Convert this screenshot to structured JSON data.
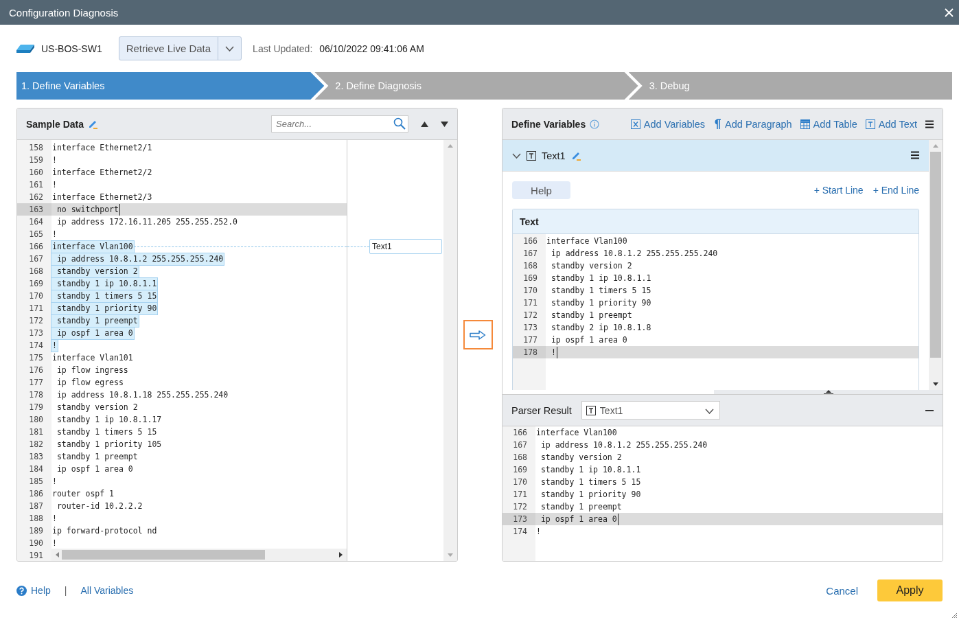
{
  "window": {
    "title": "Configuration Diagnosis"
  },
  "device": {
    "name": "US-BOS-SW1"
  },
  "retrieve_button": {
    "label": "Retrieve Live Data"
  },
  "last_updated": {
    "label": "Last Updated:",
    "value": "06/10/2022 09:41:06 AM"
  },
  "steps": [
    {
      "label": "1. Define Variables",
      "selected": true
    },
    {
      "label": "2. Define Diagnosis",
      "selected": false
    },
    {
      "label": "3. Debug",
      "selected": false
    }
  ],
  "sample_data": {
    "title": "Sample Data",
    "search_placeholder": "Search...",
    "annotation": "Text1",
    "lines": [
      {
        "number": "158",
        "text": "interface Ethernet2/1",
        "highlighted": false,
        "current": false
      },
      {
        "number": "159",
        "text": "!",
        "highlighted": false,
        "current": false
      },
      {
        "number": "160",
        "text": "interface Ethernet2/2",
        "highlighted": false,
        "current": false
      },
      {
        "number": "161",
        "text": "!",
        "highlighted": false,
        "current": false
      },
      {
        "number": "162",
        "text": "interface Ethernet2/3",
        "highlighted": false,
        "current": false
      },
      {
        "number": "163",
        "text": " no switchport",
        "highlighted": false,
        "current": true
      },
      {
        "number": "164",
        "text": " ip address 172.16.11.205 255.255.252.0",
        "highlighted": false,
        "current": false
      },
      {
        "number": "165",
        "text": "!",
        "highlighted": false,
        "current": false
      },
      {
        "number": "166",
        "text": "interface Vlan100",
        "highlighted": true,
        "current": false
      },
      {
        "number": "167",
        "text": " ip address 10.8.1.2 255.255.255.240",
        "highlighted": true,
        "current": false
      },
      {
        "number": "168",
        "text": " standby version 2",
        "highlighted": true,
        "current": false
      },
      {
        "number": "169",
        "text": " standby 1 ip 10.8.1.1",
        "highlighted": true,
        "current": false
      },
      {
        "number": "170",
        "text": " standby 1 timers 5 15",
        "highlighted": true,
        "current": false
      },
      {
        "number": "171",
        "text": " standby 1 priority 90",
        "highlighted": true,
        "current": false
      },
      {
        "number": "172",
        "text": " standby 1 preempt",
        "highlighted": true,
        "current": false
      },
      {
        "number": "173",
        "text": " ip ospf 1 area 0",
        "highlighted": true,
        "current": false
      },
      {
        "number": "174",
        "text": "!",
        "highlighted": true,
        "current": false
      },
      {
        "number": "175",
        "text": "interface Vlan101",
        "highlighted": false,
        "current": false
      },
      {
        "number": "176",
        "text": " ip flow ingress",
        "highlighted": false,
        "current": false
      },
      {
        "number": "177",
        "text": " ip flow egress",
        "highlighted": false,
        "current": false
      },
      {
        "number": "178",
        "text": " ip address 10.8.1.18 255.255.255.240",
        "highlighted": false,
        "current": false
      },
      {
        "number": "179",
        "text": " standby version 2",
        "highlighted": false,
        "current": false
      },
      {
        "number": "180",
        "text": " standby 1 ip 10.8.1.17",
        "highlighted": false,
        "current": false
      },
      {
        "number": "181",
        "text": " standby 1 timers 5 15",
        "highlighted": false,
        "current": false
      },
      {
        "number": "182",
        "text": " standby 1 priority 105",
        "highlighted": false,
        "current": false
      },
      {
        "number": "183",
        "text": " standby 1 preempt",
        "highlighted": false,
        "current": false
      },
      {
        "number": "184",
        "text": " ip ospf 1 area 0",
        "highlighted": false,
        "current": false
      },
      {
        "number": "185",
        "text": "!",
        "highlighted": false,
        "current": false
      },
      {
        "number": "186",
        "text": "router ospf 1",
        "highlighted": false,
        "current": false
      },
      {
        "number": "187",
        "text": " router-id 10.2.2.2",
        "highlighted": false,
        "current": false
      },
      {
        "number": "188",
        "text": "!",
        "highlighted": false,
        "current": false
      },
      {
        "number": "189",
        "text": "ip forward-protocol nd",
        "highlighted": false,
        "current": false
      },
      {
        "number": "190",
        "text": "!",
        "highlighted": false,
        "current": false
      },
      {
        "number": "191"
      }
    ]
  },
  "define_variables": {
    "title": "Define Variables",
    "actions": [
      {
        "label": "Add Variables",
        "kind": "variables"
      },
      {
        "label": "Add Paragraph",
        "kind": "paragraph"
      },
      {
        "label": "Add Table",
        "kind": "table"
      },
      {
        "label": "Add Text",
        "kind": "text"
      }
    ],
    "item": {
      "name": "Text1",
      "expanded": true,
      "help": "Help",
      "start_line": "+ Start Line",
      "end_line": "+ End Line",
      "text_box": {
        "title": "Text",
        "lines": [
          {
            "number": "166",
            "text": "interface Vlan100",
            "current": false
          },
          {
            "number": "167",
            "text": " ip address 10.8.1.2 255.255.255.240",
            "current": false
          },
          {
            "number": "168",
            "text": " standby version 2",
            "current": false
          },
          {
            "number": "169",
            "text": " standby 1 ip 10.8.1.1",
            "current": false
          },
          {
            "number": "170",
            "text": " standby 1 timers 5 15",
            "current": false
          },
          {
            "number": "171",
            "text": " standby 1 priority 90",
            "current": false
          },
          {
            "number": "172",
            "text": " standby 1 preempt",
            "current": false
          },
          {
            "number": "173",
            "text": " standby 2 ip 10.8.1.8",
            "current": false
          },
          {
            "number": "177",
            "text": " ip ospf 1 area 0",
            "current": false
          },
          {
            "number": "178",
            "text": " !",
            "current": true
          }
        ]
      }
    }
  },
  "parser_result": {
    "title": "Parser Result",
    "selected_variable": "Text1",
    "lines": [
      {
        "number": "166",
        "text": "interface Vlan100",
        "current": false
      },
      {
        "number": "167",
        "text": " ip address 10.8.1.2 255.255.255.240",
        "current": false
      },
      {
        "number": "168",
        "text": " standby version 2",
        "current": false
      },
      {
        "number": "169",
        "text": " standby 1 ip 10.8.1.1",
        "current": false
      },
      {
        "number": "170",
        "text": " standby 1 timers 5 15",
        "current": false
      },
      {
        "number": "171",
        "text": " standby 1 priority 90",
        "current": false
      },
      {
        "number": "172",
        "text": " standby 1 preempt",
        "current": false
      },
      {
        "number": "173",
        "text": " ip ospf 1 area 0",
        "current": true
      },
      {
        "number": "174",
        "text": "!",
        "current": false
      }
    ]
  },
  "footer": {
    "help": "Help",
    "separator": "|",
    "all_variables": "All Variables",
    "cancel": "Cancel",
    "apply": "Apply"
  }
}
